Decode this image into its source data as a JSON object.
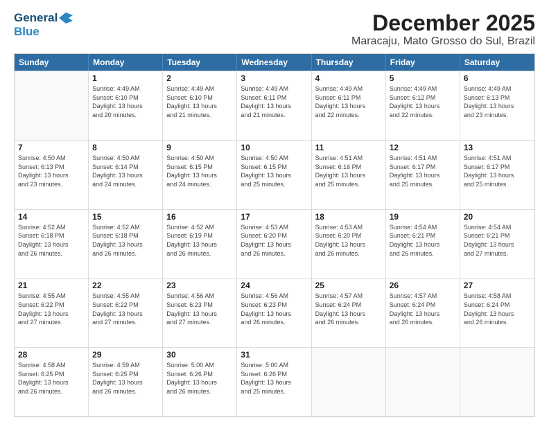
{
  "header": {
    "logo_line1": "General",
    "logo_line2": "Blue",
    "title": "December 2025",
    "subtitle": "Maracaju, Mato Grosso do Sul, Brazil"
  },
  "days_of_week": [
    "Sunday",
    "Monday",
    "Tuesday",
    "Wednesday",
    "Thursday",
    "Friday",
    "Saturday"
  ],
  "weeks": [
    [
      {
        "day": "",
        "detail": ""
      },
      {
        "day": "1",
        "detail": "Sunrise: 4:49 AM\nSunset: 6:10 PM\nDaylight: 13 hours\nand 20 minutes."
      },
      {
        "day": "2",
        "detail": "Sunrise: 4:49 AM\nSunset: 6:10 PM\nDaylight: 13 hours\nand 21 minutes."
      },
      {
        "day": "3",
        "detail": "Sunrise: 4:49 AM\nSunset: 6:11 PM\nDaylight: 13 hours\nand 21 minutes."
      },
      {
        "day": "4",
        "detail": "Sunrise: 4:49 AM\nSunset: 6:11 PM\nDaylight: 13 hours\nand 22 minutes."
      },
      {
        "day": "5",
        "detail": "Sunrise: 4:49 AM\nSunset: 6:12 PM\nDaylight: 13 hours\nand 22 minutes."
      },
      {
        "day": "6",
        "detail": "Sunrise: 4:49 AM\nSunset: 6:13 PM\nDaylight: 13 hours\nand 23 minutes."
      }
    ],
    [
      {
        "day": "7",
        "detail": "Sunrise: 4:50 AM\nSunset: 6:13 PM\nDaylight: 13 hours\nand 23 minutes."
      },
      {
        "day": "8",
        "detail": "Sunrise: 4:50 AM\nSunset: 6:14 PM\nDaylight: 13 hours\nand 24 minutes."
      },
      {
        "day": "9",
        "detail": "Sunrise: 4:50 AM\nSunset: 6:15 PM\nDaylight: 13 hours\nand 24 minutes."
      },
      {
        "day": "10",
        "detail": "Sunrise: 4:50 AM\nSunset: 6:15 PM\nDaylight: 13 hours\nand 25 minutes."
      },
      {
        "day": "11",
        "detail": "Sunrise: 4:51 AM\nSunset: 6:16 PM\nDaylight: 13 hours\nand 25 minutes."
      },
      {
        "day": "12",
        "detail": "Sunrise: 4:51 AM\nSunset: 6:17 PM\nDaylight: 13 hours\nand 25 minutes."
      },
      {
        "day": "13",
        "detail": "Sunrise: 4:51 AM\nSunset: 6:17 PM\nDaylight: 13 hours\nand 25 minutes."
      }
    ],
    [
      {
        "day": "14",
        "detail": "Sunrise: 4:52 AM\nSunset: 6:18 PM\nDaylight: 13 hours\nand 26 minutes."
      },
      {
        "day": "15",
        "detail": "Sunrise: 4:52 AM\nSunset: 6:18 PM\nDaylight: 13 hours\nand 26 minutes."
      },
      {
        "day": "16",
        "detail": "Sunrise: 4:52 AM\nSunset: 6:19 PM\nDaylight: 13 hours\nand 26 minutes."
      },
      {
        "day": "17",
        "detail": "Sunrise: 4:53 AM\nSunset: 6:20 PM\nDaylight: 13 hours\nand 26 minutes."
      },
      {
        "day": "18",
        "detail": "Sunrise: 4:53 AM\nSunset: 6:20 PM\nDaylight: 13 hours\nand 26 minutes."
      },
      {
        "day": "19",
        "detail": "Sunrise: 4:54 AM\nSunset: 6:21 PM\nDaylight: 13 hours\nand 26 minutes."
      },
      {
        "day": "20",
        "detail": "Sunrise: 4:54 AM\nSunset: 6:21 PM\nDaylight: 13 hours\nand 27 minutes."
      }
    ],
    [
      {
        "day": "21",
        "detail": "Sunrise: 4:55 AM\nSunset: 6:22 PM\nDaylight: 13 hours\nand 27 minutes."
      },
      {
        "day": "22",
        "detail": "Sunrise: 4:55 AM\nSunset: 6:22 PM\nDaylight: 13 hours\nand 27 minutes."
      },
      {
        "day": "23",
        "detail": "Sunrise: 4:56 AM\nSunset: 6:23 PM\nDaylight: 13 hours\nand 27 minutes."
      },
      {
        "day": "24",
        "detail": "Sunrise: 4:56 AM\nSunset: 6:23 PM\nDaylight: 13 hours\nand 26 minutes."
      },
      {
        "day": "25",
        "detail": "Sunrise: 4:57 AM\nSunset: 6:24 PM\nDaylight: 13 hours\nand 26 minutes."
      },
      {
        "day": "26",
        "detail": "Sunrise: 4:57 AM\nSunset: 6:24 PM\nDaylight: 13 hours\nand 26 minutes."
      },
      {
        "day": "27",
        "detail": "Sunrise: 4:58 AM\nSunset: 6:24 PM\nDaylight: 13 hours\nand 26 minutes."
      }
    ],
    [
      {
        "day": "28",
        "detail": "Sunrise: 4:58 AM\nSunset: 6:25 PM\nDaylight: 13 hours\nand 26 minutes."
      },
      {
        "day": "29",
        "detail": "Sunrise: 4:59 AM\nSunset: 6:25 PM\nDaylight: 13 hours\nand 26 minutes."
      },
      {
        "day": "30",
        "detail": "Sunrise: 5:00 AM\nSunset: 6:26 PM\nDaylight: 13 hours\nand 26 minutes."
      },
      {
        "day": "31",
        "detail": "Sunrise: 5:00 AM\nSunset: 6:26 PM\nDaylight: 13 hours\nand 25 minutes."
      },
      {
        "day": "",
        "detail": ""
      },
      {
        "day": "",
        "detail": ""
      },
      {
        "day": "",
        "detail": ""
      }
    ]
  ]
}
